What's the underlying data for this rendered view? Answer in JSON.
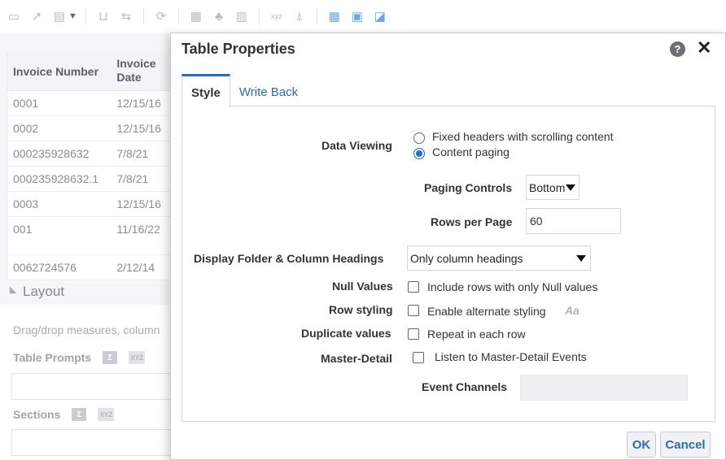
{
  "toolbar": {
    "icons": [
      "print-icon",
      "export-icon",
      "format-icon",
      "pivot-icon",
      "swap-icon",
      "refresh-icon",
      "add-column-icon",
      "add-measure-icon",
      "add-calc-icon",
      "xyz-icon",
      "sort-icon",
      "grid-icon",
      "table-properties-icon",
      "chart-icon"
    ]
  },
  "background_table": {
    "headers": [
      "Invoice Number",
      "Invoice Date"
    ],
    "rows": [
      [
        "0001",
        "12/15/16"
      ],
      [
        "0002",
        "12/15/16"
      ],
      [
        "000235928632",
        "7/8/21"
      ],
      [
        "000235928632.1",
        "7/8/21"
      ],
      [
        "0003",
        "12/15/16"
      ],
      [
        "001",
        "11/16/22"
      ],
      [
        "0062724576",
        "2/12/14"
      ]
    ]
  },
  "layout_panel": {
    "title": "Layout",
    "hint": "Drag/drop measures, column",
    "table_prompts": "Table Prompts",
    "sections": "Sections",
    "sigma": "Σ",
    "xyz": "XYZ"
  },
  "dialog": {
    "title": "Table Properties",
    "help": "?",
    "close": "✕",
    "tabs": [
      {
        "label": "Style",
        "active": true
      },
      {
        "label": "Write Back",
        "active": false
      }
    ],
    "data_viewing": {
      "label": "Data Viewing",
      "options": [
        "Fixed headers with scrolling content",
        "Content paging"
      ],
      "selected": "Content paging"
    },
    "paging_controls": {
      "label": "Paging Controls",
      "value": "Bottom"
    },
    "rows_per_page": {
      "label": "Rows per Page",
      "value": "60"
    },
    "folder_headings": {
      "label": "Display Folder & Column Headings",
      "value": "Only column headings"
    },
    "null_values": {
      "label": "Null Values",
      "text": "Include rows with only Null values",
      "checked": false
    },
    "row_styling": {
      "label": "Row styling",
      "text": "Enable alternate styling",
      "checked": false,
      "icon": "Aa"
    },
    "duplicate_values": {
      "label": "Duplicate values",
      "text": "Repeat in each row",
      "checked": false
    },
    "master_detail": {
      "label": "Master-Detail",
      "text": "Listen to Master-Detail Events",
      "checked": false
    },
    "event_channels": {
      "label": "Event Channels",
      "value": ""
    },
    "buttons": {
      "ok": "OK",
      "cancel": "Cancel"
    },
    "colors": {
      "accent": "#1f6fc5",
      "link": "#2b6cb0"
    }
  }
}
